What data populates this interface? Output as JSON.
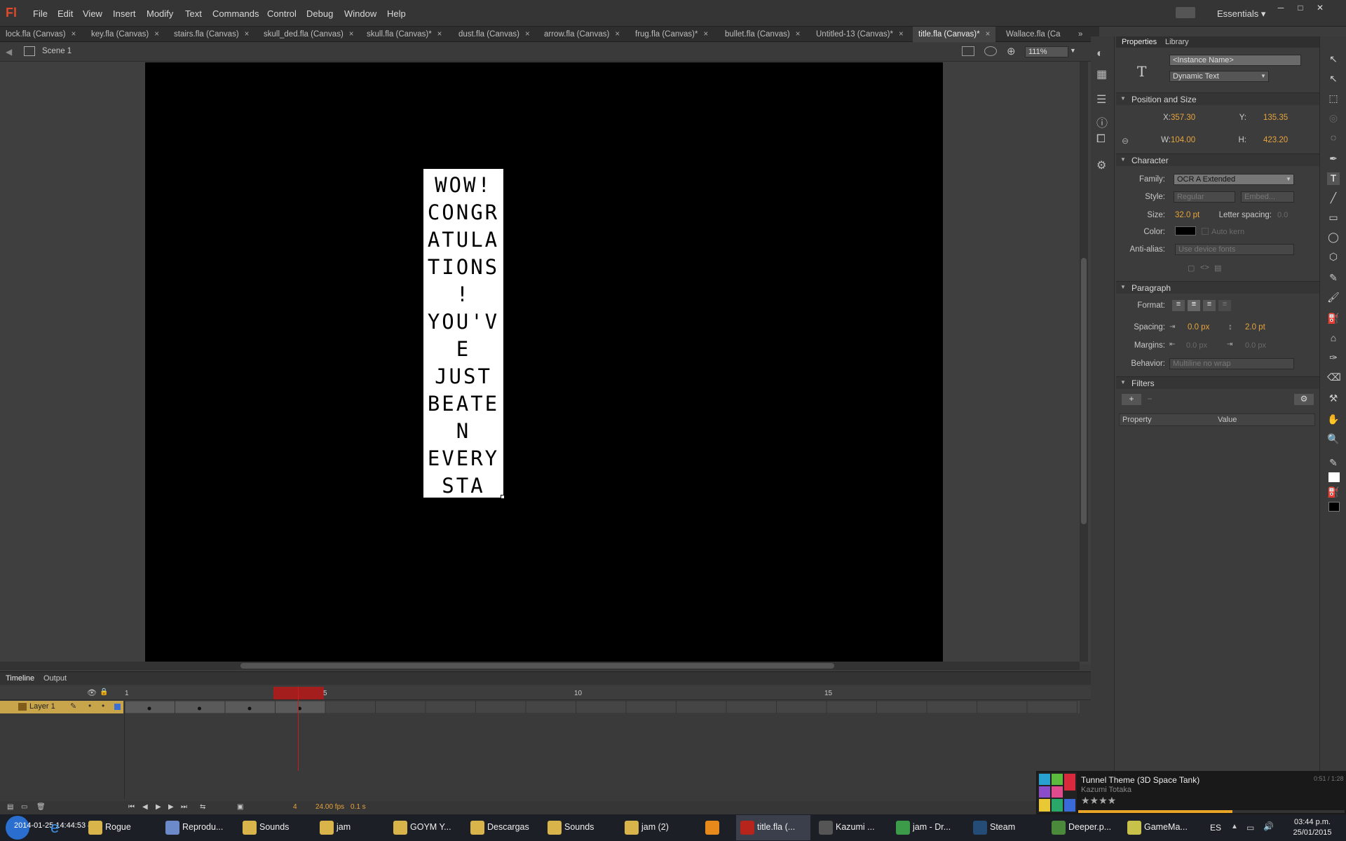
{
  "menubar": {
    "logo": "Fl",
    "items": [
      "File",
      "Edit",
      "View",
      "Insert",
      "Modify",
      "Text",
      "Commands",
      "Control",
      "Debug",
      "Window",
      "Help"
    ],
    "workspace": "Essentials",
    "workspace_caret": "▾",
    "window_controls": [
      "─",
      "□",
      "✕"
    ]
  },
  "tabs": [
    {
      "label": "lock.fla (Canvas)",
      "active": false
    },
    {
      "label": "key.fla (Canvas)",
      "active": false
    },
    {
      "label": "stairs.fla (Canvas)",
      "active": false
    },
    {
      "label": "skull_ded.fla (Canvas)",
      "active": false
    },
    {
      "label": "skull.fla (Canvas)*",
      "active": false
    },
    {
      "label": "dust.fla (Canvas)",
      "active": false
    },
    {
      "label": "arrow.fla (Canvas)",
      "active": false
    },
    {
      "label": "frug.fla (Canvas)*",
      "active": false
    },
    {
      "label": "bullet.fla (Canvas)",
      "active": false
    },
    {
      "label": "Untitled-13 (Canvas)*",
      "active": false
    },
    {
      "label": "title.fla (Canvas)*",
      "active": true
    },
    {
      "label": "Wallace.fla (Ca",
      "active": false
    }
  ],
  "tab_close": "×",
  "tabs_overflow": "»",
  "edit_header": {
    "scene": "Scene 1",
    "zoom": "111%",
    "back_arrow": "◀"
  },
  "stage_text_lines": [
    "WOW!",
    "CONGR",
    "ATULA",
    "TIONS",
    "!",
    "YOU'V",
    "E",
    "JUST",
    "BEATE",
    "N",
    "EVERY",
    "STA"
  ],
  "timeline": {
    "tabs": [
      "Timeline",
      "Output"
    ],
    "layer": "Layer 1",
    "frame_numbers": [
      "1",
      "5",
      "10",
      "15"
    ],
    "current_frame": "4",
    "fps": "24.00 fps",
    "time": "0.1 s",
    "playhead_frame": 4,
    "keyframes": [
      1,
      2,
      3,
      4
    ]
  },
  "properties": {
    "tabs": [
      "Properties",
      "Library"
    ],
    "type_icon": "T",
    "instance_name": "<Instance Name>",
    "text_type": "Dynamic Text",
    "sections": {
      "position": "Position and Size",
      "character": "Character",
      "paragraph": "Paragraph",
      "filters": "Filters"
    },
    "x_label": "X:",
    "x": "357.30",
    "y_label": "Y:",
    "y": "135.35",
    "w_label": "W:",
    "w": "104.00",
    "h_label": "H:",
    "h": "423.20",
    "family_label": "Family:",
    "family": "OCR A Extended",
    "style_label": "Style:",
    "style": "Regular",
    "embed": "Embed...",
    "size_label": "Size:",
    "size": "32.0 pt",
    "letter_spacing_label": "Letter spacing:",
    "letter_spacing": "0.0",
    "color_label": "Color:",
    "auto_kern": "Auto kern",
    "antialias_label": "Anti-alias:",
    "antialias": "Use device fonts",
    "format_label": "Format:",
    "spacing_label": "Spacing:",
    "spacing_indent": "0.0 px",
    "spacing_line": "2.0 pt",
    "margins_label": "Margins:",
    "margin_left": "0.0 px",
    "margin_right": "0.0 px",
    "behavior_label": "Behavior:",
    "behavior": "Multiline no wrap",
    "filters_cols": [
      "Property",
      "Value"
    ],
    "colors": {
      "accent": "#e6a43c",
      "text_color": "#000000"
    }
  },
  "music": {
    "title": "Tunnel Theme (3D Space Tank)",
    "artist": "Kazumi Totaka",
    "time": "0:51 / 1:28",
    "stars": "★★★★",
    "progress": 0.58
  },
  "taskbar": {
    "clock_time": "03:44 p.m.",
    "clock_date": "25/01/2015",
    "language": "ES",
    "overlay": "2014-01-25 14:44:53 4:43",
    "items": [
      {
        "label": "Rogue",
        "icon": "folder-icon",
        "color": "#d9b44a"
      },
      {
        "label": "Reprodu...",
        "icon": "media-player-icon",
        "color": "#6c8ac9"
      },
      {
        "label": "Sounds",
        "icon": "folder-icon",
        "color": "#d9b44a"
      },
      {
        "label": "jam",
        "icon": "folder-icon",
        "color": "#d9b44a"
      },
      {
        "label": "GOYM Y...",
        "icon": "folder-icon",
        "color": "#d9b44a"
      },
      {
        "label": "Descargas",
        "icon": "folder-icon",
        "color": "#d9b44a"
      },
      {
        "label": "Sounds",
        "icon": "folder-icon",
        "color": "#d9b44a"
      },
      {
        "label": "jam (2)",
        "icon": "folder-icon",
        "color": "#d9b44a"
      },
      {
        "label": "",
        "icon": "vlc-icon",
        "color": "#e8891c"
      },
      {
        "label": "title.fla (...",
        "icon": "flash-icon",
        "color": "#b6241c"
      },
      {
        "label": "Kazumi ...",
        "icon": "winamp-icon",
        "color": "#555"
      },
      {
        "label": "jam - Dr...",
        "icon": "chrome-icon",
        "color": "#3b9b49"
      },
      {
        "label": "Steam",
        "icon": "steam-icon",
        "color": "#244c76"
      },
      {
        "label": "Deeper.p...",
        "icon": "app-icon",
        "color": "#4a8a3a"
      },
      {
        "label": "GameMa...",
        "icon": "gamemaker-icon",
        "color": "#c9c24a"
      }
    ]
  }
}
